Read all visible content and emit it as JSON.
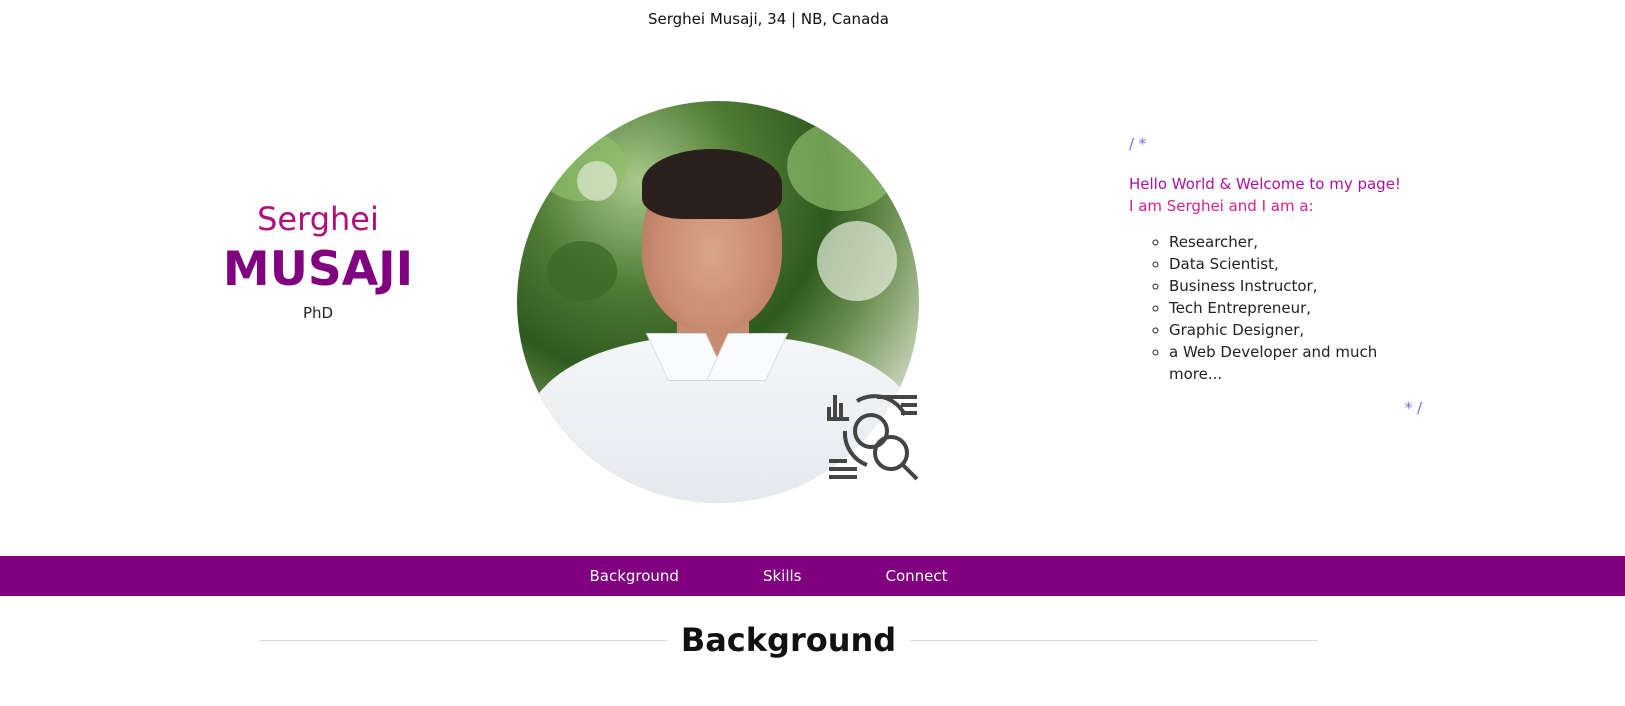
{
  "header": {
    "location_line": "Serghei Musaji, 34 | NB, Canada"
  },
  "hero": {
    "first_name": "Serghei",
    "last_name": "MUSAJI",
    "degree": "PhD",
    "photo_icon": "person-photo",
    "overlay_icon": "data-analytics-icon"
  },
  "intro": {
    "comment_open": "/ *",
    "hello": "Hello World & Welcome to my page!",
    "iam": "I am Serghei and I am a:",
    "roles": [
      "Researcher,",
      "Data Scientist,",
      "Business Instructor,",
      "Tech Entrepreneur,",
      "Graphic Designer,",
      "a Web Developer and much more..."
    ],
    "comment_close": "* /"
  },
  "nav": {
    "items": [
      {
        "label": "Background"
      },
      {
        "label": "Skills"
      },
      {
        "label": "Connect"
      }
    ],
    "background_color": "#800080"
  },
  "section": {
    "title": "Background"
  },
  "colors": {
    "accent_purple": "#800080",
    "accent_magenta": "#b0107a",
    "comment_color": "#7b68ee"
  }
}
